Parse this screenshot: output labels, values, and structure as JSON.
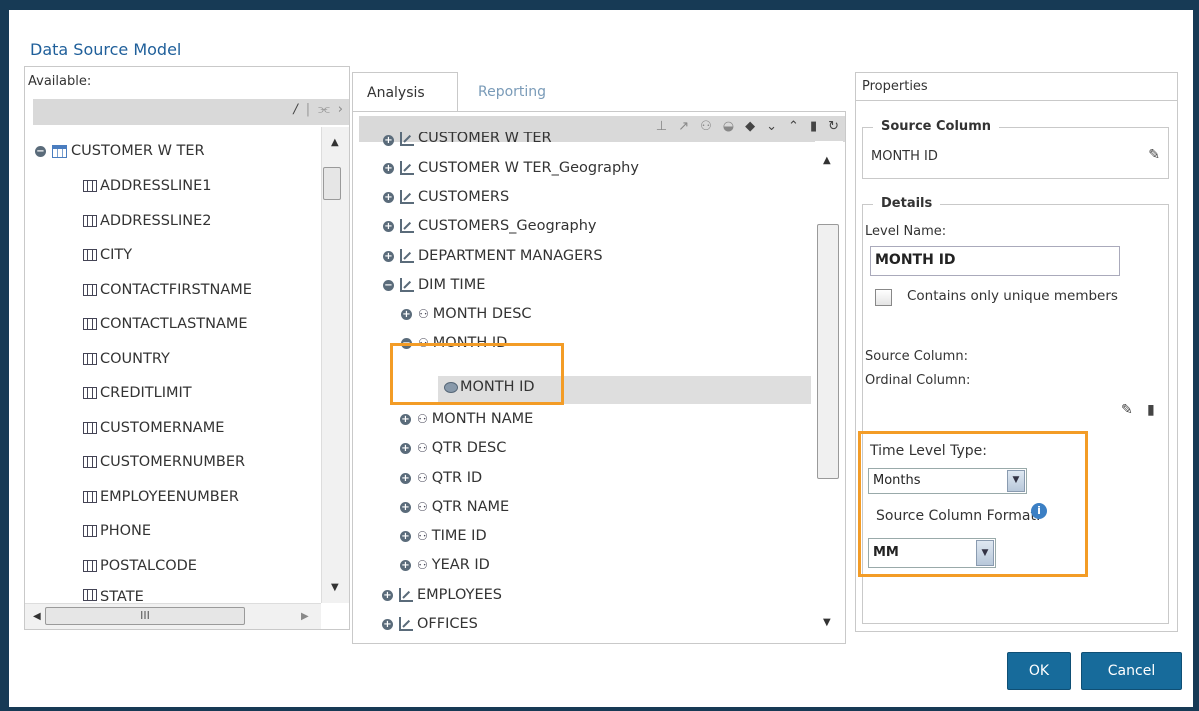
{
  "dialog": {
    "title": "Data Source Model",
    "ok_label": "OK",
    "cancel_label": "Cancel"
  },
  "available": {
    "label": "Available:",
    "table_name": "CUSTOMER W TER",
    "columns": [
      "ADDRESSLINE1",
      "ADDRESSLINE2",
      "CITY",
      "CONTACTFIRSTNAME",
      "CONTACTLASTNAME",
      "COUNTRY",
      "CREDITLIMIT",
      "CUSTOMERNAME",
      "CUSTOMERNUMBER",
      "EMPLOYEENUMBER",
      "PHONE",
      "POSTALCODE",
      "STATE"
    ],
    "hscroll_label": "III"
  },
  "tabs": {
    "analysis": "Analysis",
    "reporting": "Reporting"
  },
  "analysis_tree": {
    "partial_top": "CUSTOMER W TER",
    "items": [
      "CUSTOMER W TER_Geography",
      "CUSTOMERS",
      "CUSTOMERS_Geography",
      "DEPARTMENT MANAGERS",
      "DIM TIME",
      "MONTH DESC",
      "MONTH ID",
      "MONTH ID",
      "MONTH NAME",
      "QTR DESC",
      "QTR ID",
      "QTR NAME",
      "TIME ID",
      "YEAR ID",
      "EMPLOYEES",
      "OFFICES"
    ]
  },
  "properties": {
    "title": "Properties",
    "source_column_legend": "Source Column",
    "source_column_value": "MONTH ID",
    "details_legend": "Details",
    "level_name_label": "Level Name:",
    "level_name_value": "MONTH ID",
    "unique_members_label": "Contains only unique members",
    "source_column_label": "Source Column:",
    "ordinal_column_label": "Ordinal Column:",
    "time_level_type_label": "Time Level Type:",
    "time_level_type_value": "Months",
    "source_column_format_label": "Source Column Format:",
    "source_column_format_value": "MM"
  },
  "colors": {
    "accent": "#176b9b",
    "highlight": "#f39c26",
    "title": "#1f5f9a"
  }
}
